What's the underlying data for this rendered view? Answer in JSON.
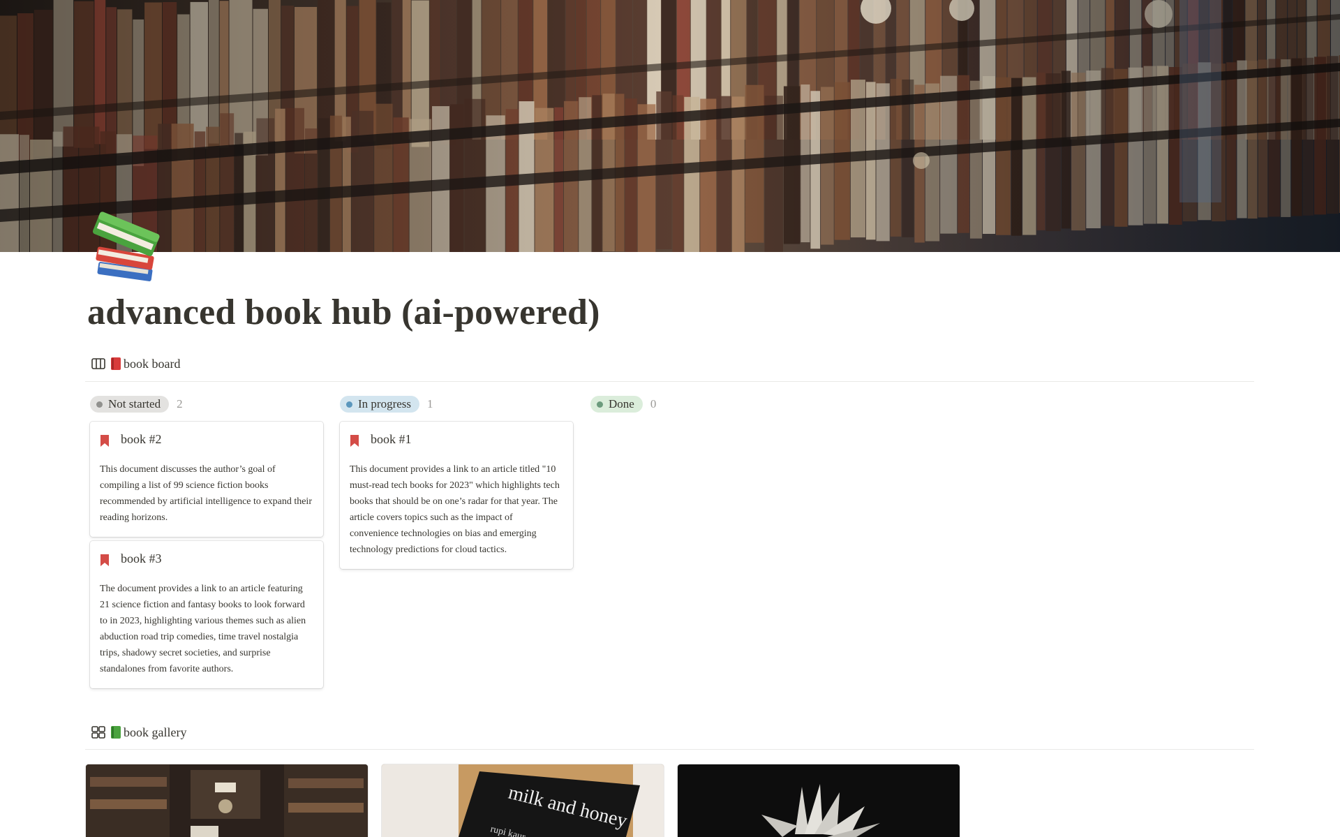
{
  "page": {
    "title": "advanced book hub (ai-powered)",
    "icon": "books-emoji-icon",
    "cover": "library-bookshelves-photo"
  },
  "views": {
    "board": {
      "label": "book board",
      "icon": "board-view-icon",
      "emoji": "red-book-emoji"
    },
    "gallery": {
      "label": "book gallery",
      "icon": "gallery-view-icon",
      "emoji": "green-book-emoji"
    }
  },
  "board": {
    "columns": [
      {
        "status": "Not started",
        "count": "2",
        "dot": "#91918e",
        "bg": "#e3e2e0",
        "cards": [
          {
            "title": "book #2",
            "body": "This document discusses the author’s goal of compiling a list of 99 science fiction books recommended by artificial intelligence to expand their reading horizons."
          },
          {
            "title": "book #3",
            "body": "The document provides a link to an article featuring 21 science fiction and fantasy books to look forward to in 2023, highlighting various themes such as alien abduction road trip comedies, time travel nostalgia trips, shadowy secret societies, and surprise standalones from favorite authors."
          }
        ]
      },
      {
        "status": "In progress",
        "count": "1",
        "dot": "#5b97bd",
        "bg": "#d3e5ef",
        "cards": [
          {
            "title": "book #1",
            "body": "This document provides a link to an article titled \"10 must-read tech books for 2023\" which highlights tech books that should be on one’s radar for that year. The article covers topics such as the impact of convenience technologies on bias and emerging technology predictions for cloud tactics."
          }
        ]
      },
      {
        "status": "Done",
        "count": "0",
        "dot": "#6c9b7d",
        "bg": "#dbeddb",
        "cards": []
      }
    ]
  },
  "gallery": {
    "cards": [
      {
        "image": "bookstore-aisle-photo"
      },
      {
        "image": "milk-and-honey-book-photo",
        "cover_title": "milk and honey",
        "cover_author": "rupi kaur"
      },
      {
        "image": "open-book-dark-photo"
      }
    ]
  },
  "colors": {
    "bookmark": "#d44c47",
    "text": "#37352f",
    "muted": "#9b9a97"
  }
}
